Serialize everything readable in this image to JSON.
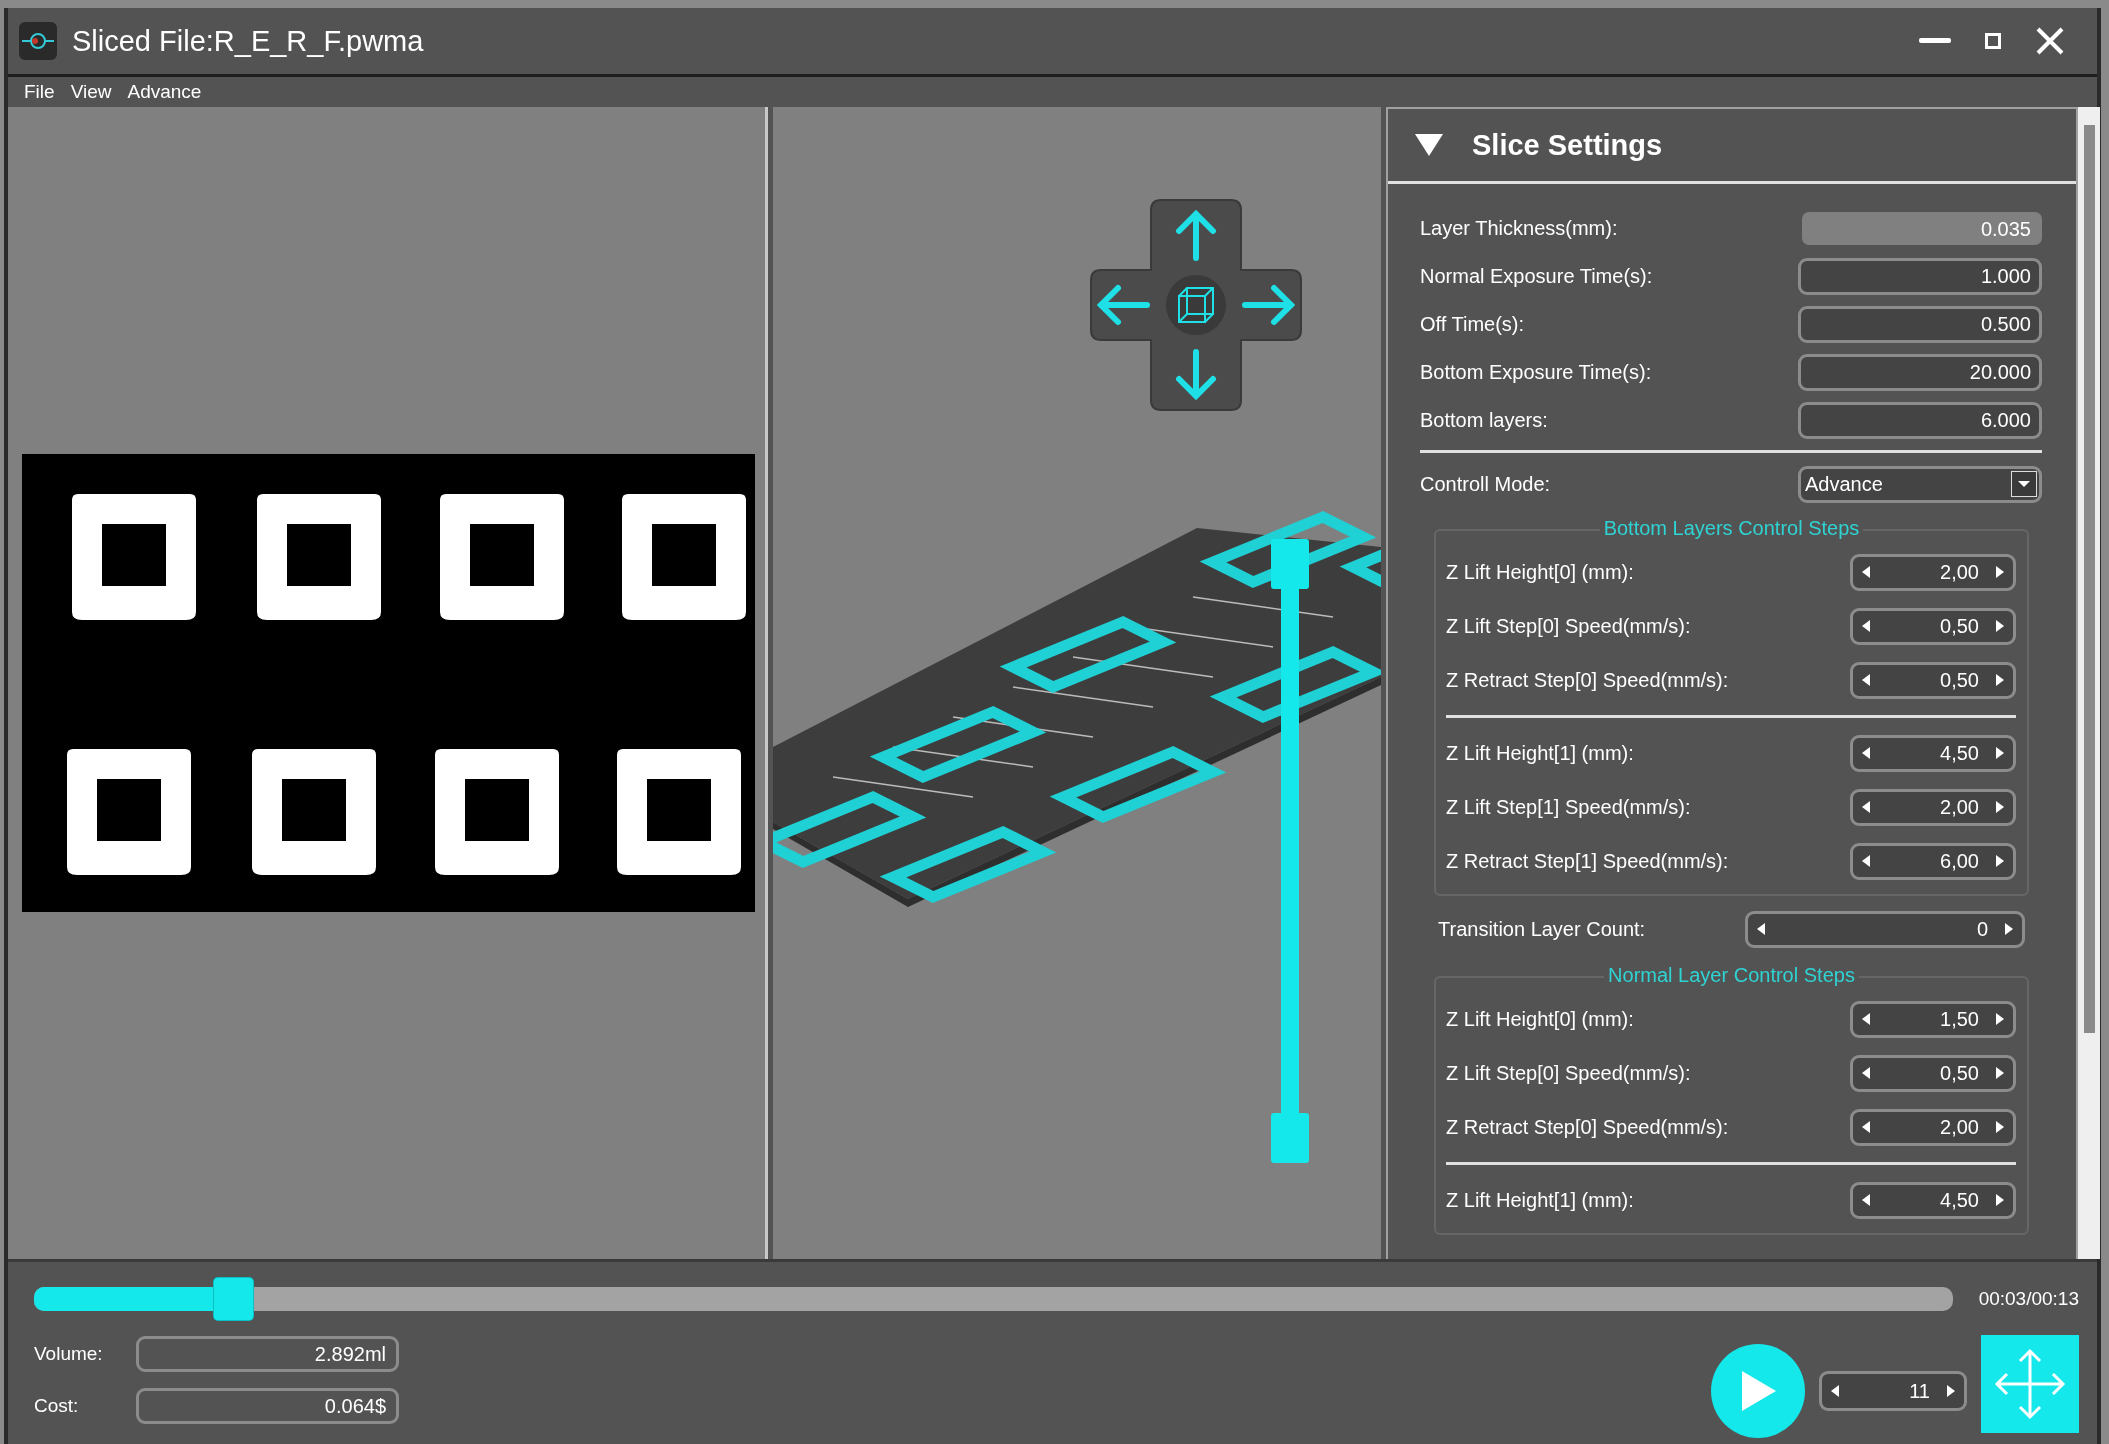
{
  "window": {
    "title": "Sliced File:R_E_R_F.pwma"
  },
  "menu": [
    "File",
    "View",
    "Advance"
  ],
  "slice_settings": {
    "title": "Slice Settings",
    "expanded": true,
    "fields": [
      {
        "label": "Layer Thickness(mm):",
        "value": "0.035",
        "disabled": true
      },
      {
        "label": "Normal Exposure Time(s):",
        "value": "1.000",
        "disabled": false
      },
      {
        "label": "Off Time(s):",
        "value": "0.500",
        "disabled": false
      },
      {
        "label": "Bottom Exposure Time(s):",
        "value": "20.000",
        "disabled": false
      },
      {
        "label": "Bottom layers:",
        "value": "6.000",
        "disabled": false
      }
    ],
    "control_mode": {
      "label": "Controll Mode:",
      "value": "Advance"
    },
    "bottom_steps": {
      "title": "Bottom Layers Control Steps",
      "groups": [
        [
          {
            "label": "Z Lift Height[0] (mm):",
            "value": "2,00"
          },
          {
            "label": "Z Lift Step[0] Speed(mm/s):",
            "value": "0,50"
          },
          {
            "label": "Z Retract Step[0] Speed(mm/s):",
            "value": "0,50"
          }
        ],
        [
          {
            "label": "Z Lift Height[1] (mm):",
            "value": "4,50"
          },
          {
            "label": "Z Lift Step[1] Speed(mm/s):",
            "value": "2,00"
          },
          {
            "label": "Z Retract Step[1] Speed(mm/s):",
            "value": "6,00"
          }
        ]
      ]
    },
    "transition": {
      "label": "Transition Layer Count:",
      "value": "0"
    },
    "normal_steps": {
      "title": "Normal Layer Control Steps",
      "groups": [
        [
          {
            "label": "Z Lift Height[0] (mm):",
            "value": "1,50"
          },
          {
            "label": "Z Lift Step[0] Speed(mm/s):",
            "value": "0,50"
          },
          {
            "label": "Z Retract Step[0] Speed(mm/s):",
            "value": "2,00"
          }
        ],
        [
          {
            "label": "Z Lift Height[1] (mm):",
            "value": "4,50"
          }
        ]
      ]
    }
  },
  "playback": {
    "level": 0.098,
    "time": "00:03/00:13",
    "volume": {
      "label": "Volume:",
      "value": "2.892ml"
    },
    "cost": {
      "label": "Cost:",
      "value": "0.064$"
    },
    "layer": "11"
  }
}
